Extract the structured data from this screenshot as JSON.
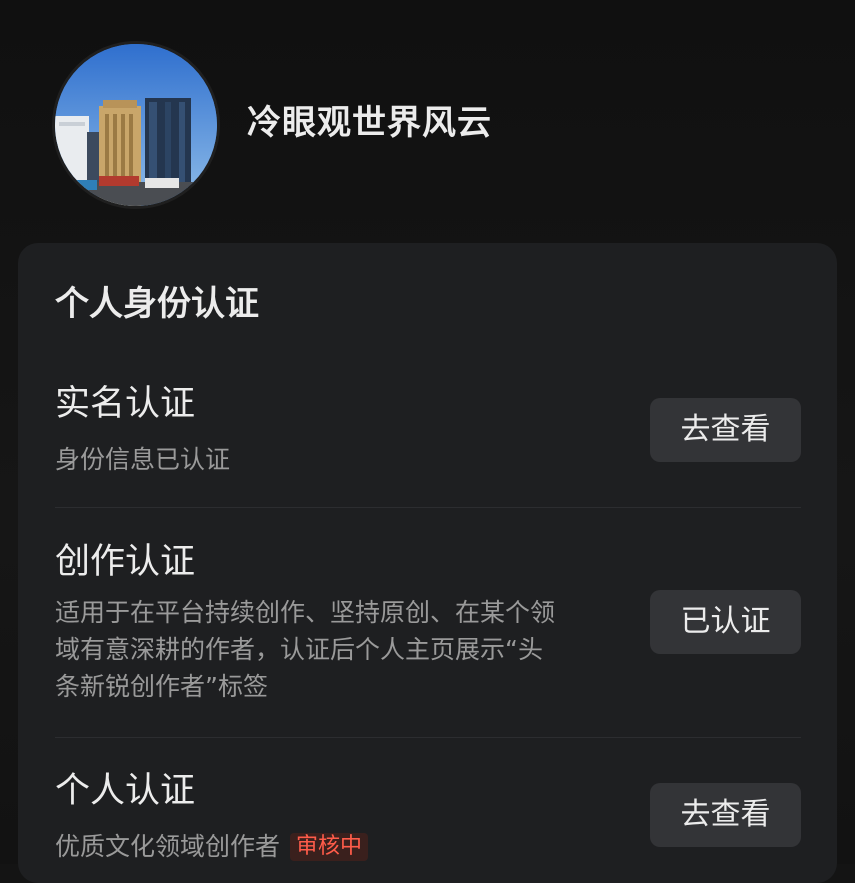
{
  "profile": {
    "username": "冷眼观世界风云",
    "avatar_icon": "city-buildings-avatar"
  },
  "section": {
    "title": "个人身份认证",
    "items": [
      {
        "title": "实名认证",
        "description": [
          "身份信息已认证"
        ],
        "button_label": "去查看"
      },
      {
        "title": "创作认证",
        "description": [
          "适用于在平台持续创作、坚持原创、在某个领",
          "域有意深耕的作者，认证后个人主页展示“头",
          "条新锐创作者”标签"
        ],
        "button_label": "已认证"
      },
      {
        "title": "个人认证",
        "description": [
          "优质文化领域创作者"
        ],
        "status_badge": "审核中",
        "button_label": "去查看"
      }
    ]
  },
  "colors": {
    "background": "#141414",
    "card": "#1e1f21",
    "button": "#333437",
    "pending": "#ff5c4a"
  }
}
